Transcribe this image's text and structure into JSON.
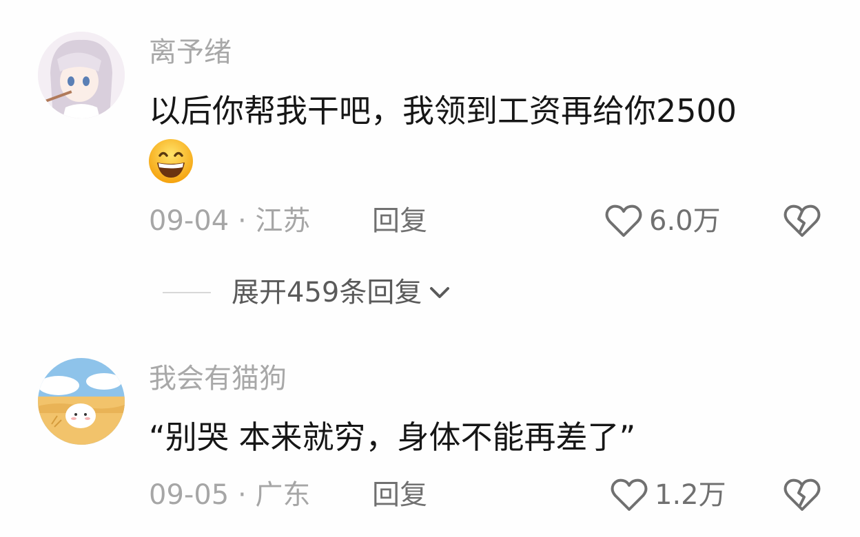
{
  "comments": [
    {
      "username": "离予绪",
      "text": "以后你帮我干吧，我领到工资再给你2500",
      "date_location": "09-04 · 江苏",
      "reply_label": "回复",
      "likes": "6.0万"
    },
    {
      "username": "我会有猫狗",
      "text": "“别哭 本来就穷，身体不能再差了”",
      "date_location": "09-05 · 广东",
      "reply_label": "回复",
      "likes": "1.2万"
    }
  ],
  "expand_replies_label": "展开459条回复",
  "colors": {
    "username": "#a8a8a8",
    "text": "#161616",
    "meta": "#a6a6a6",
    "action": "#707070"
  },
  "icons": {
    "like": "heart-outline-icon",
    "dislike": "broken-heart-icon",
    "expand": "chevron-down-icon",
    "emoji": "grinning-face-emoji"
  }
}
